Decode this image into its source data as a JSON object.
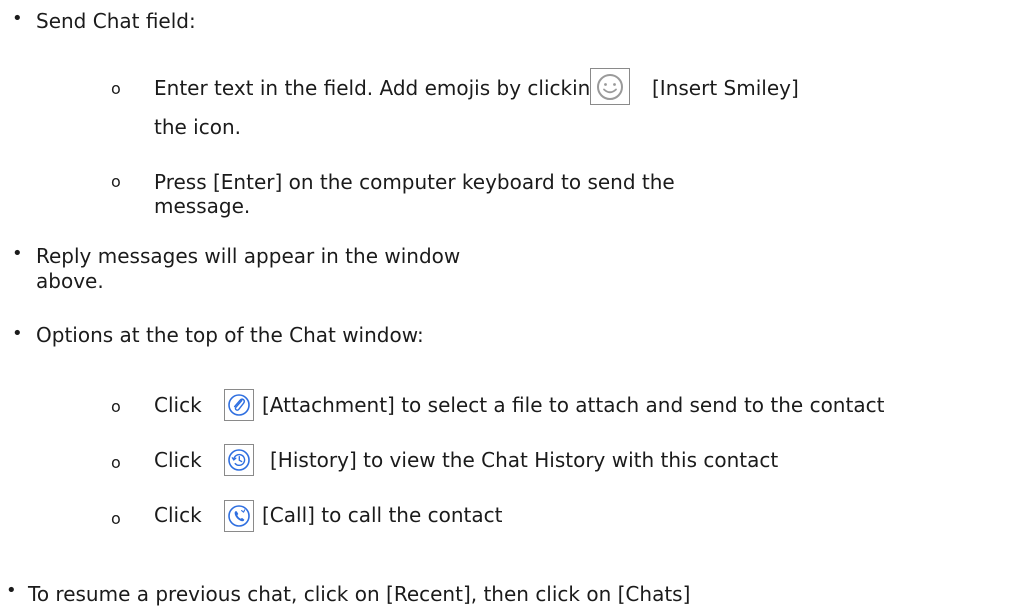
{
  "bullets": {
    "top_marker": "•",
    "sub_marker": "o"
  },
  "section1": {
    "title": "Send Chat field:",
    "sub1_line1_before": "Enter text in the field. Add emojis by clicking",
    "sub1_line1_after": "[Insert Smiley]",
    "sub1_line2": "the icon.",
    "sub2_line1": "Press [Enter] on the computer keyboard to send the",
    "sub2_line2": "message."
  },
  "section2": {
    "line1": "Reply messages will appear in the window",
    "line2": "above."
  },
  "section3": {
    "title": "Options at the top of the Chat window:",
    "items": [
      {
        "click": "Click",
        "text": "[Attachment] to select a file to attach and send to the contact",
        "icon": "paperclip-icon"
      },
      {
        "click": "Click",
        "text": "[History] to view the Chat History with this contact",
        "icon": "history-icon"
      },
      {
        "click": "Click",
        "text": "[Call] to call the contact",
        "icon": "phone-icon"
      }
    ]
  },
  "section4": {
    "text": "To resume a previous chat, click on [Recent], then click on [Chats]"
  },
  "colors": {
    "text": "#1b1b1b",
    "icon_border": "#8a8a8a",
    "icon_blue": "#2f6fe0",
    "smiley_gray": "#9a9a9a"
  }
}
